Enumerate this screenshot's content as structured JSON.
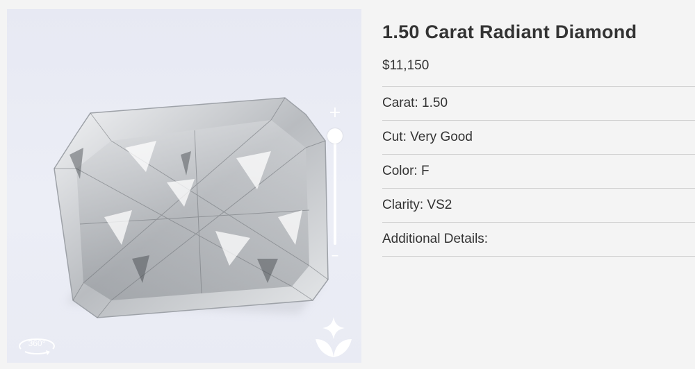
{
  "product": {
    "title": "1.50 Carat Radiant Diamond",
    "price": "$11,150"
  },
  "specs": [
    {
      "label": "Carat:",
      "value": "1.50"
    },
    {
      "label": "Cut:",
      "value": "Very Good"
    },
    {
      "label": "Color:",
      "value": "F"
    },
    {
      "label": "Clarity:",
      "value": "VS2"
    },
    {
      "label": "Additional Details:",
      "value": ""
    }
  ],
  "viewer": {
    "zoom_in": "+",
    "zoom_out": "–",
    "rotate_label": "360°",
    "icons": [
      "plus-icon",
      "minus-icon",
      "rotate-360-icon",
      "brand-logo"
    ],
    "background_color": "#e9ebf4"
  }
}
